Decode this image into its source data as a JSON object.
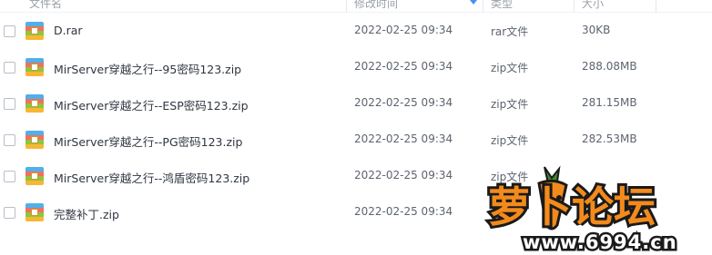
{
  "header": {
    "col_name": "文件名",
    "col_modified": "修改时间",
    "col_type": "类型",
    "col_size": "大小"
  },
  "files": [
    {
      "name": "D.rar",
      "modified": "2022-02-25 09:34",
      "type": "rar文件",
      "size": "30KB"
    },
    {
      "name": "MirServer穿越之行--95密码123.zip",
      "modified": "2022-02-25 09:34",
      "type": "zip文件",
      "size": "288.08MB"
    },
    {
      "name": "MirServer穿越之行--ESP密码123.zip",
      "modified": "2022-02-25 09:34",
      "type": "zip文件",
      "size": "281.15MB"
    },
    {
      "name": "MirServer穿越之行--PG密码123.zip",
      "modified": "2022-02-25 09:34",
      "type": "zip文件",
      "size": "282.53MB"
    },
    {
      "name": "MirServer穿越之行--鸿盾密码123.zip",
      "modified": "2022-02-25 09:34",
      "type": "zip文件",
      "size": ""
    },
    {
      "name": "完整补丁.zip",
      "modified": "2022-02-25 09:34",
      "type": "",
      "size": ""
    }
  ],
  "watermark": {
    "logo_text": "萝卜论坛",
    "url_text": "www.6994.cn",
    "colors": {
      "orange": "#f28a1c",
      "dark": "#1a1a1a",
      "white": "#ffffff"
    }
  },
  "icons": {
    "file_icon": "archive-file-icon"
  }
}
